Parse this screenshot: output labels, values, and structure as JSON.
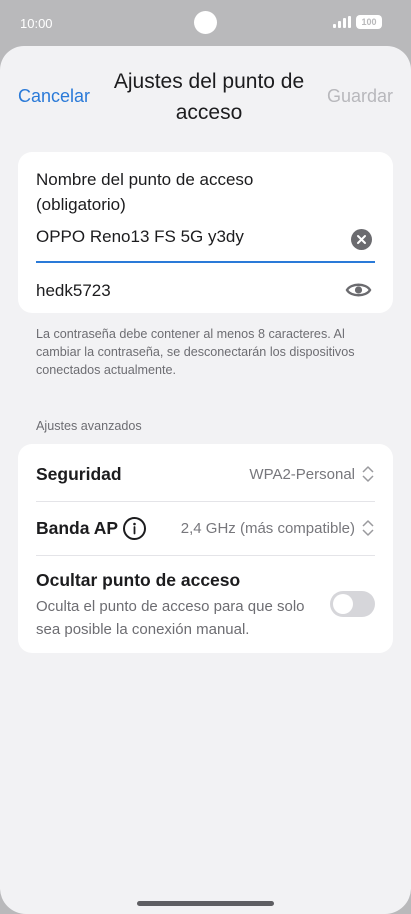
{
  "status_bar": {
    "time": "10:00",
    "battery": "100"
  },
  "nav": {
    "cancel_label": "Cancelar",
    "title": "Ajustes del punto de acceso",
    "save_label": "Guardar"
  },
  "hotspot_form": {
    "name_label": "Nombre del punto de acceso (obligatorio)",
    "name_value": "OPPO Reno13 FS 5G y3dy",
    "password_value": "hedk5723"
  },
  "helper_text": "La contraseña debe contener al menos 8 caracteres. Al cambiar la contraseña, se desconectarán los dispositivos conectados actualmente.",
  "advanced": {
    "header": "Ajustes avanzados",
    "security_label": "Seguridad",
    "security_value": "WPA2-Personal",
    "band_label": "Banda AP",
    "band_value": "2,4 GHz (más compatible)",
    "hide_label": "Ocultar punto de acceso",
    "hide_description": "Oculta el punto de acceso para que solo sea posible la conexión manual.",
    "hide_enabled": false
  },
  "colors": {
    "accent": "#2a7ad8",
    "disabled": "#b8b8bc",
    "background": "#f2f2f4"
  },
  "icons": [
    "clear-icon",
    "eye-icon",
    "info-icon",
    "sort-arrows-icon",
    "signal-icon",
    "battery-icon"
  ]
}
